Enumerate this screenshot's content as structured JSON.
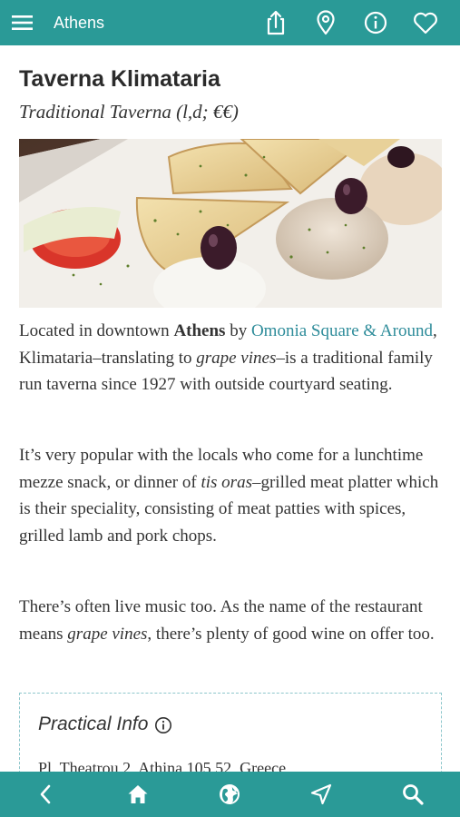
{
  "header": {
    "title": "Athens",
    "icons": [
      "menu-icon",
      "share-icon",
      "location-pin-icon",
      "info-icon",
      "heart-icon"
    ]
  },
  "place": {
    "name": "Taverna Klimataria",
    "subtitle": "Traditional Taverna (l,d; €€)",
    "image_alt": "Plate of pita bread wedges with dips, olives and tomato slice"
  },
  "paragraph1": {
    "t1": "Located in downtown ",
    "bold1": "Athens",
    "t2": " by ",
    "link1": "Omonia Square & Around",
    "t3": ", Klimataria–translating to ",
    "em1": "grape vines",
    "t4": "–is a traditional family run taverna since 1927 with outside courtyard seating."
  },
  "paragraph2": {
    "t1": "It’s very popular with the locals who come for a lunchtime mezze snack, or dinner of ",
    "em1": "tis oras",
    "t2": "–grilled meat platter which is their speciality, consisting of meat patties with spices, grilled lamb and pork chops."
  },
  "paragraph3": {
    "t1": "There’s often live music too. As the name of the restaurant means ",
    "em1": "grape vines",
    "t2": ", there’s plenty of good wine on offer too."
  },
  "practical_info": {
    "heading": "Practical Info",
    "address": "Pl. Theatrou 2, Athina 105 52, Greece"
  },
  "bottom_nav": {
    "icons": [
      "back-icon",
      "home-icon",
      "globe-icon",
      "navigate-icon",
      "search-icon"
    ]
  },
  "colors": {
    "bar": "#2a9a97",
    "link": "#2e8c9a",
    "info_border": "#8ec7cc"
  }
}
